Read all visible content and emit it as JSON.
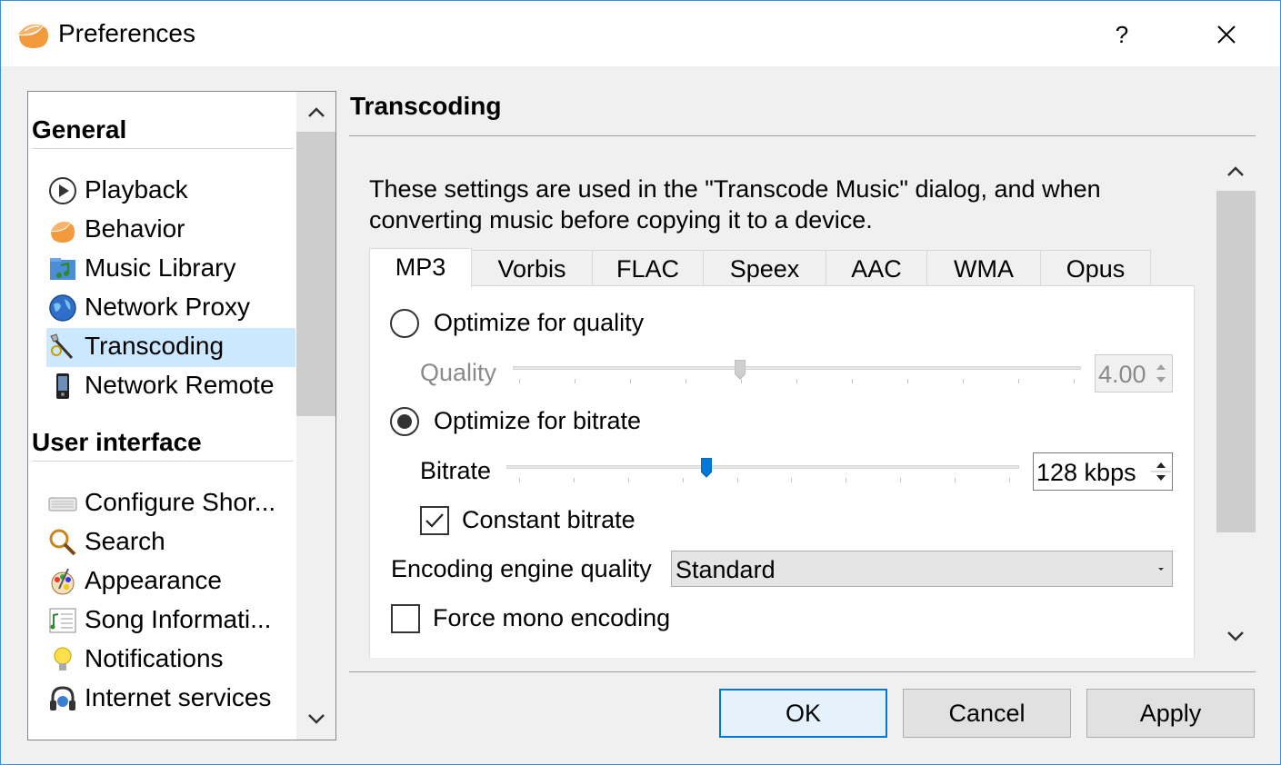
{
  "window": {
    "title": "Preferences",
    "help_label": "?",
    "close_icon": "close-icon"
  },
  "sidebar": {
    "sections": [
      {
        "title": "General"
      },
      {
        "title": "User interface"
      }
    ],
    "items": [
      {
        "label": "Playback",
        "icon": "playback-icon"
      },
      {
        "label": "Behavior",
        "icon": "clementine-icon"
      },
      {
        "label": "Music Library",
        "icon": "music-library-icon"
      },
      {
        "label": "Network Proxy",
        "icon": "globe-icon"
      },
      {
        "label": "Transcoding",
        "icon": "transcoding-wand-icon",
        "selected": true
      },
      {
        "label": "Network Remote",
        "icon": "phone-icon"
      },
      {
        "label": "Configure Shor...",
        "icon": "keyboard-icon"
      },
      {
        "label": "Search",
        "icon": "search-icon"
      },
      {
        "label": "Appearance",
        "icon": "appearance-icon"
      },
      {
        "label": "Song Informati...",
        "icon": "song-info-icon"
      },
      {
        "label": "Notifications",
        "icon": "lightbulb-icon"
      },
      {
        "label": "Internet services",
        "icon": "headphones-icon"
      }
    ]
  },
  "page": {
    "title": "Transcoding",
    "description": "These settings are used in the \"Transcode Music\" dialog, and when converting music before copying it to a device.",
    "tabs": [
      "MP3",
      "Vorbis",
      "FLAC",
      "Speex",
      "AAC",
      "WMA",
      "Opus"
    ],
    "active_tab": "MP3",
    "mp3": {
      "optimize_quality_label": "Optimize for quality",
      "optimize_quality_selected": false,
      "quality_label": "Quality",
      "quality_value": "4.00",
      "quality_slider_fraction": 0.4,
      "optimize_bitrate_label": "Optimize for bitrate",
      "optimize_bitrate_selected": true,
      "bitrate_label": "Bitrate",
      "bitrate_value": "128 kbps",
      "bitrate_slider_fraction": 0.39,
      "constant_bitrate_label": "Constant bitrate",
      "constant_bitrate_checked": true,
      "encoding_quality_label": "Encoding engine quality",
      "encoding_quality_value": "Standard",
      "force_mono_label": "Force mono encoding",
      "force_mono_checked": false
    }
  },
  "buttons": {
    "ok": "OK",
    "cancel": "Cancel",
    "apply": "Apply"
  },
  "colors": {
    "accent": "#0078d7",
    "selection": "#cce8ff",
    "clementine": "#f08c38"
  }
}
